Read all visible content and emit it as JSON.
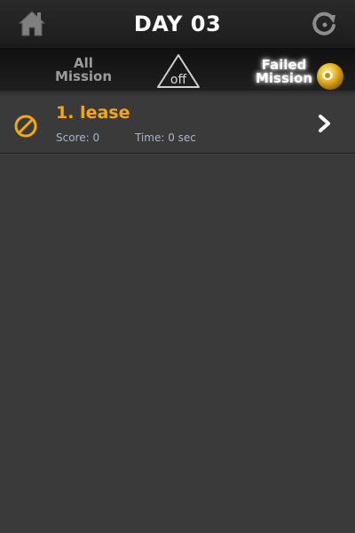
{
  "header": {
    "title": "DAY 03"
  },
  "filters": {
    "all_line1": "All",
    "all_line2": "Mission",
    "toggle_label": "off",
    "failed_line1": "Failed",
    "failed_line2": "Mission"
  },
  "icons": {
    "home": "home-icon",
    "refresh": "refresh-icon",
    "ball": "yellow-ball-icon",
    "ban": "ban-icon",
    "chevron": "chevron-right-icon"
  },
  "colors": {
    "accent": "#f5a80c",
    "meta": "#a7b5c8",
    "background": "#3a3a3a"
  },
  "missions": [
    {
      "title": "1. lease",
      "score_label": "Score:",
      "score_value": "0",
      "time_label": "Time:",
      "time_value": "0 sec"
    }
  ]
}
